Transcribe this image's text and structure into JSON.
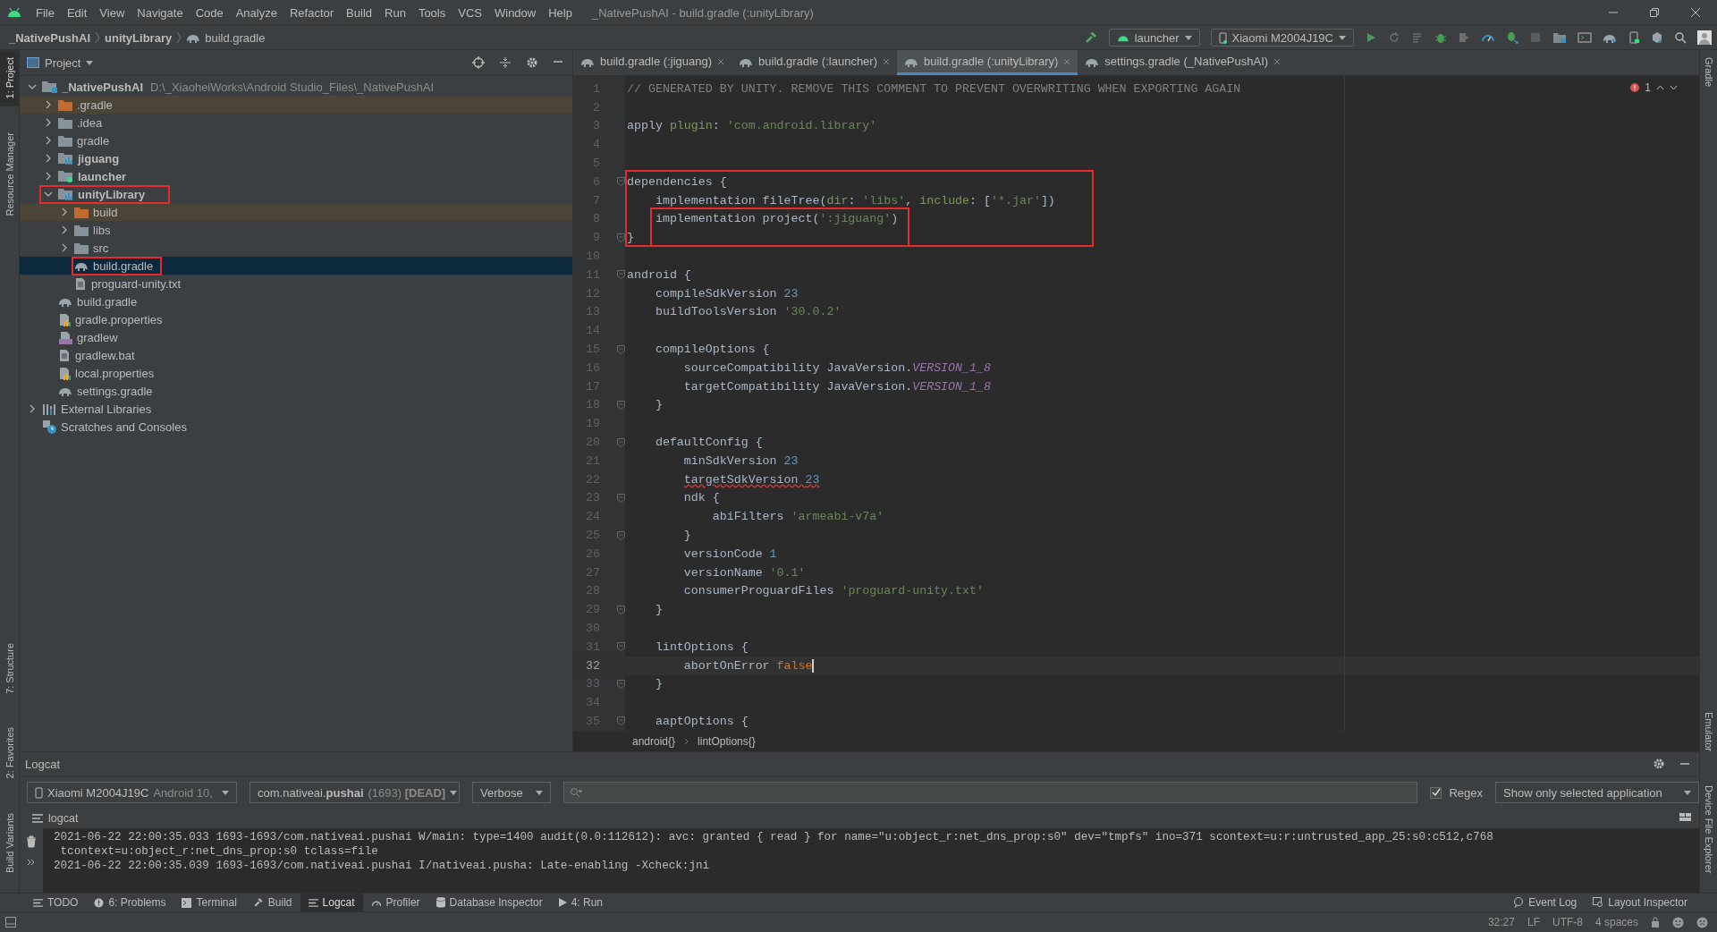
{
  "menu_bar": {
    "items": [
      "File",
      "Edit",
      "View",
      "Navigate",
      "Code",
      "Analyze",
      "Refactor",
      "Build",
      "Run",
      "Tools",
      "VCS",
      "Window",
      "Help"
    ],
    "title": "_NativePushAI - build.gradle (:unityLibrary)"
  },
  "breadcrumb": [
    {
      "label": "_NativePushAI",
      "kind": "module"
    },
    {
      "label": "unityLibrary",
      "kind": "module"
    },
    {
      "label": "build.gradle",
      "kind": "gradle"
    }
  ],
  "toolbar": {
    "run_config": "launcher",
    "device": "Xiaomi M2004J19C"
  },
  "left_strip": {
    "top": [
      {
        "label": "1: Project",
        "selected": true
      },
      {
        "label": "Resource Manager",
        "selected": false
      }
    ],
    "bottom": [
      {
        "label": "7: Structure",
        "selected": false
      },
      {
        "label": "2: Favorites",
        "selected": false
      },
      {
        "label": "Build Variants",
        "selected": false
      }
    ]
  },
  "right_strip": {
    "top": [
      {
        "label": "Gradle",
        "selected": false
      }
    ],
    "bottom": [
      {
        "label": "Emulator",
        "selected": false
      },
      {
        "label": "Device File Explorer",
        "selected": false
      }
    ]
  },
  "project_panel": {
    "title": "Project",
    "tree": [
      {
        "label": "_NativePushAI",
        "path": "D:\\_XiaoheiWorks\\Android Studio_Files\\_NativePushAI",
        "kind": "module-root",
        "expanded": true,
        "selected": false,
        "annotated": false,
        "children": [
          {
            "label": ".gradle",
            "kind": "folder-excluded",
            "expanded": false,
            "selected": false,
            "annotated": false
          },
          {
            "label": ".idea",
            "kind": "folder",
            "expanded": false,
            "selected": false,
            "annotated": false
          },
          {
            "label": "gradle",
            "kind": "folder",
            "expanded": false,
            "selected": false,
            "annotated": false
          },
          {
            "label": "jiguang",
            "kind": "module",
            "expanded": false,
            "selected": false,
            "annotated": false
          },
          {
            "label": "launcher",
            "kind": "module-app",
            "expanded": false,
            "selected": false,
            "annotated": false
          },
          {
            "label": "unityLibrary",
            "kind": "module",
            "expanded": true,
            "selected": false,
            "annotated": true,
            "children": [
              {
                "label": "build",
                "kind": "folder-excluded",
                "expanded": false,
                "selected": false,
                "annotated": false
              },
              {
                "label": "libs",
                "kind": "folder",
                "expanded": false,
                "selected": false,
                "annotated": false
              },
              {
                "label": "src",
                "kind": "folder",
                "expanded": false,
                "selected": false,
                "annotated": false
              },
              {
                "label": "build.gradle",
                "kind": "gradle",
                "selected": true,
                "annotated": true
              },
              {
                "label": "proguard-unity.txt",
                "kind": "text",
                "selected": false,
                "annotated": false
              }
            ]
          },
          {
            "label": "build.gradle",
            "kind": "gradle",
            "selected": false,
            "annotated": false
          },
          {
            "label": "gradle.properties",
            "kind": "properties",
            "selected": false,
            "annotated": false
          },
          {
            "label": "gradlew",
            "kind": "script",
            "selected": false,
            "annotated": false
          },
          {
            "label": "gradlew.bat",
            "kind": "text",
            "selected": false,
            "annotated": false
          },
          {
            "label": "local.properties",
            "kind": "properties",
            "selected": false,
            "annotated": false
          },
          {
            "label": "settings.gradle",
            "kind": "gradle",
            "selected": false,
            "annotated": false
          }
        ]
      },
      {
        "label": "External Libraries",
        "kind": "libraries",
        "expanded": false,
        "selected": false,
        "annotated": false
      },
      {
        "label": "Scratches and Consoles",
        "kind": "scratches",
        "selected": false,
        "annotated": false
      }
    ]
  },
  "editor": {
    "tabs": [
      {
        "label": "build.gradle (:jiguang)",
        "selected": false
      },
      {
        "label": "build.gradle (:launcher)",
        "selected": false
      },
      {
        "label": "build.gradle (:unityLibrary)",
        "selected": true
      },
      {
        "label": "settings.gradle (_NativePushAI)",
        "selected": false
      }
    ],
    "error_count": "1",
    "lines": [
      {
        "number": "1",
        "fold": false,
        "current": false,
        "boxed": false,
        "inner_boxed": false,
        "tokens": [
          {
            "kind": "comment",
            "text": "// GENERATED BY UNITY. REMOVE THIS COMMENT TO PREVENT OVERWRITING WHEN EXPORTING AGAIN"
          }
        ]
      },
      {
        "number": "2",
        "fold": false,
        "current": false,
        "boxed": false,
        "inner_boxed": false
      },
      {
        "number": "3",
        "fold": false,
        "current": false,
        "boxed": false,
        "inner_boxed": false,
        "tokens": [
          {
            "kind": "plain",
            "text": "apply "
          },
          {
            "kind": "param",
            "text": "plugin"
          },
          {
            "kind": "plain",
            "text": ": "
          },
          {
            "kind": "string",
            "text": "'com.android.library'"
          }
        ]
      },
      {
        "number": "4",
        "fold": false,
        "current": false,
        "boxed": false,
        "inner_boxed": false
      },
      {
        "number": "5",
        "fold": false,
        "current": false,
        "boxed": false,
        "inner_boxed": false
      },
      {
        "number": "6",
        "fold": true,
        "current": false,
        "boxed": true,
        "inner_boxed": false,
        "tokens": [
          {
            "kind": "plain",
            "text": "dependencies {"
          }
        ]
      },
      {
        "number": "7",
        "fold": false,
        "current": false,
        "boxed": true,
        "inner_boxed": false,
        "tokens": [
          {
            "kind": "plain",
            "text": "    implementation fileTree("
          },
          {
            "kind": "param",
            "text": "dir"
          },
          {
            "kind": "plain",
            "text": ": "
          },
          {
            "kind": "string",
            "text": "'libs'"
          },
          {
            "kind": "plain",
            "text": ", "
          },
          {
            "kind": "param",
            "text": "include"
          },
          {
            "kind": "plain",
            "text": ": ["
          },
          {
            "kind": "string",
            "text": "'*.jar'"
          },
          {
            "kind": "plain",
            "text": "])"
          }
        ]
      },
      {
        "number": "8",
        "fold": false,
        "current": false,
        "boxed": true,
        "inner_boxed": true,
        "tokens": [
          {
            "kind": "plain",
            "text": "    implementation project("
          },
          {
            "kind": "string",
            "text": "':jiguang'"
          },
          {
            "kind": "plain",
            "text": ")"
          }
        ]
      },
      {
        "number": "9",
        "fold": true,
        "current": false,
        "boxed": true,
        "inner_boxed": true,
        "tokens": [
          {
            "kind": "plain",
            "text": "}"
          }
        ]
      },
      {
        "number": "10",
        "fold": false,
        "current": false,
        "boxed": false,
        "inner_boxed": false
      },
      {
        "number": "11",
        "fold": true,
        "current": false,
        "boxed": false,
        "inner_boxed": false,
        "tokens": [
          {
            "kind": "plain",
            "text": "android {"
          }
        ]
      },
      {
        "number": "12",
        "fold": false,
        "current": false,
        "boxed": false,
        "inner_boxed": false,
        "tokens": [
          {
            "kind": "plain",
            "text": "    compileSdkVersion "
          },
          {
            "kind": "number",
            "text": "23"
          }
        ]
      },
      {
        "number": "13",
        "fold": false,
        "current": false,
        "boxed": false,
        "inner_boxed": false,
        "tokens": [
          {
            "kind": "plain",
            "text": "    buildToolsVersion "
          },
          {
            "kind": "string",
            "text": "'30.0.2'"
          }
        ]
      },
      {
        "number": "14",
        "fold": false,
        "current": false,
        "boxed": false,
        "inner_boxed": false
      },
      {
        "number": "15",
        "fold": true,
        "current": false,
        "boxed": false,
        "inner_boxed": false,
        "tokens": [
          {
            "kind": "plain",
            "text": "    compileOptions {"
          }
        ]
      },
      {
        "number": "16",
        "fold": false,
        "current": false,
        "boxed": false,
        "inner_boxed": false,
        "tokens": [
          {
            "kind": "plain",
            "text": "        sourceCompatibility JavaVersion."
          },
          {
            "kind": "constant",
            "text": "VERSION_1_8"
          }
        ]
      },
      {
        "number": "17",
        "fold": false,
        "current": false,
        "boxed": false,
        "inner_boxed": false,
        "tokens": [
          {
            "kind": "plain",
            "text": "        targetCompatibility JavaVersion."
          },
          {
            "kind": "constant",
            "text": "VERSION_1_8"
          }
        ]
      },
      {
        "number": "18",
        "fold": true,
        "current": false,
        "boxed": false,
        "inner_boxed": false,
        "tokens": [
          {
            "kind": "plain",
            "text": "    }"
          }
        ]
      },
      {
        "number": "19",
        "fold": false,
        "current": false,
        "boxed": false,
        "inner_boxed": false
      },
      {
        "number": "20",
        "fold": true,
        "current": false,
        "boxed": false,
        "inner_boxed": false,
        "tokens": [
          {
            "kind": "plain",
            "text": "    defaultConfig {"
          }
        ]
      },
      {
        "number": "21",
        "fold": false,
        "current": false,
        "boxed": false,
        "inner_boxed": false,
        "tokens": [
          {
            "kind": "plain",
            "text": "        minSdkVersion "
          },
          {
            "kind": "number",
            "text": "23"
          }
        ]
      },
      {
        "number": "22",
        "fold": false,
        "current": false,
        "boxed": false,
        "inner_boxed": false,
        "tokens": [
          {
            "kind": "typo",
            "text": "        targetSdkVersion "
          },
          {
            "kind": "typo-number",
            "text": "23"
          }
        ]
      },
      {
        "number": "23",
        "fold": true,
        "current": false,
        "boxed": false,
        "inner_boxed": false,
        "tokens": [
          {
            "kind": "plain",
            "text": "        ndk {"
          }
        ]
      },
      {
        "number": "24",
        "fold": false,
        "current": false,
        "boxed": false,
        "inner_boxed": false,
        "tokens": [
          {
            "kind": "plain",
            "text": "            abiFilters "
          },
          {
            "kind": "string",
            "text": "'armeabi-v7a'"
          }
        ]
      },
      {
        "number": "25",
        "fold": true,
        "current": false,
        "boxed": false,
        "inner_boxed": false,
        "tokens": [
          {
            "kind": "plain",
            "text": "        }"
          }
        ]
      },
      {
        "number": "26",
        "fold": false,
        "current": false,
        "boxed": false,
        "inner_boxed": false,
        "tokens": [
          {
            "kind": "plain",
            "text": "        versionCode "
          },
          {
            "kind": "number",
            "text": "1"
          }
        ]
      },
      {
        "number": "27",
        "fold": false,
        "current": false,
        "boxed": false,
        "inner_boxed": false,
        "tokens": [
          {
            "kind": "plain",
            "text": "        versionName "
          },
          {
            "kind": "string",
            "text": "'0.1'"
          }
        ]
      },
      {
        "number": "28",
        "fold": false,
        "current": false,
        "boxed": false,
        "inner_boxed": false,
        "tokens": [
          {
            "kind": "plain",
            "text": "        consumerProguardFiles "
          },
          {
            "kind": "string",
            "text": "'proguard-unity.txt'"
          }
        ]
      },
      {
        "number": "29",
        "fold": true,
        "current": false,
        "boxed": false,
        "inner_boxed": false,
        "tokens": [
          {
            "kind": "plain",
            "text": "    }"
          }
        ]
      },
      {
        "number": "30",
        "fold": false,
        "current": false,
        "boxed": false,
        "inner_boxed": false
      },
      {
        "number": "31",
        "fold": true,
        "current": false,
        "boxed": false,
        "inner_boxed": false,
        "tokens": [
          {
            "kind": "plain",
            "text": "    lintOptions {"
          }
        ]
      },
      {
        "number": "32",
        "fold": false,
        "current": true,
        "boxed": false,
        "inner_boxed": false,
        "tokens": [
          {
            "kind": "plain",
            "text": "        abortOnError "
          },
          {
            "kind": "keyword",
            "text": "false"
          }
        ]
      },
      {
        "number": "33",
        "fold": true,
        "current": false,
        "boxed": false,
        "inner_boxed": false,
        "tokens": [
          {
            "kind": "plain",
            "text": "    }"
          }
        ]
      },
      {
        "number": "34",
        "fold": false,
        "current": false,
        "boxed": false,
        "inner_boxed": false
      },
      {
        "number": "35",
        "fold": true,
        "current": false,
        "boxed": false,
        "inner_boxed": false,
        "tokens": [
          {
            "kind": "plain",
            "text": "    aaptOptions {"
          }
        ]
      }
    ],
    "breadcrumb": [
      "android{}",
      "lintOptions{}"
    ]
  },
  "logcat": {
    "title": "Logcat",
    "device": "Xiaomi M2004J19C",
    "device_detail": "Android 10,",
    "process": "com.nativeai.**pushai**",
    "process_detail": "(1693) **[DEAD]**",
    "log_level": "Verbose",
    "regex": {
      "label": "Regex",
      "checked": true
    },
    "filter": "Show only selected application",
    "source_label": "logcat",
    "lines": [
      "2021-06-22 22:00:35.033 1693-1693/com.nativeai.pushai W/main: type=1400 audit(0.0:112612): avc: granted { read } for name=\"u:object_r:net_dns_prop:s0\" dev=\"tmpfs\" ino=371 scontext=u:r:untrusted_app_25:s0:c512,c768",
      " tcontext=u:object_r:net_dns_prop:s0 tclass=file",
      "2021-06-22 22:00:35.039 1693-1693/com.nativeai.pushai I/nativeai.pusha: Late-enabling -Xcheck:jni"
    ]
  },
  "tool_tabs": [
    {
      "label": "TODO",
      "kind": "list",
      "selected": false
    },
    {
      "label": "6: Problems",
      "kind": "info",
      "selected": false
    },
    {
      "label": "Terminal",
      "kind": "terminal",
      "selected": false
    },
    {
      "label": "Build",
      "kind": "hammer",
      "selected": false
    },
    {
      "label": "Logcat",
      "kind": "list",
      "selected": true
    },
    {
      "label": "Profiler",
      "kind": "gauge",
      "selected": false
    },
    {
      "label": "Database Inspector",
      "kind": "database",
      "selected": false
    },
    {
      "label": "4: Run",
      "kind": "play",
      "selected": false
    }
  ],
  "right_tool_tabs": [
    {
      "label": "Event Log",
      "kind": "bubble",
      "selected": false
    },
    {
      "label": "Layout Inspector",
      "kind": "inspector",
      "selected": false
    }
  ],
  "status_bar": [
    "32:27",
    "LF",
    "UTF-8",
    "4 spaces"
  ]
}
